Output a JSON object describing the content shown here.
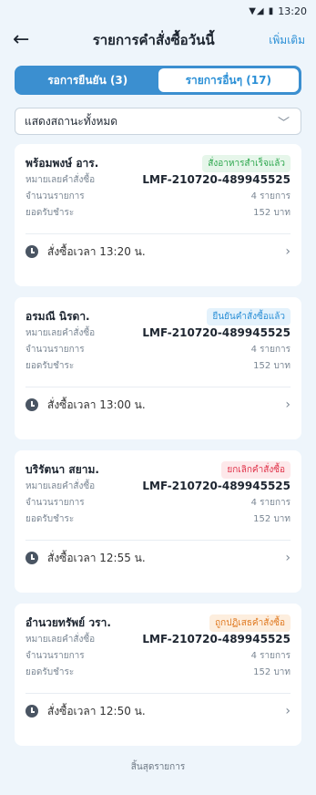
{
  "status": {
    "time": "13:20"
  },
  "header": {
    "title": "รายการคำสั่งซื้อวันนี้",
    "add_label": "เพิ่มเติม"
  },
  "tabs": [
    {
      "label": "รอการยืนยัน (3)",
      "active": false
    },
    {
      "label": "รายการอื่นๆ (17)",
      "active": true
    }
  ],
  "filter": {
    "label": "แสดงสถานะทั้งหมด"
  },
  "labels": {
    "order_no": "หมายเลยคำสั่งซื้อ",
    "items": "จำนวนรายการ",
    "payment": "ยอดรับชำระ"
  },
  "orders": [
    {
      "name": "พร้อมพงษ์ อาร.",
      "status": "สั่งอาหารสำเร็จแล้ว",
      "order_no": "LMF-210720-489945525",
      "items": "4 รายการ",
      "payment": "152 บาท",
      "time": "สั่งซื้อเวลา 13:20 น."
    },
    {
      "name": "อรมณี นิรดา.",
      "status": "ยืนยันคำสั่งซื้อแล้ว",
      "order_no": "LMF-210720-489945525",
      "items": "4 รายการ",
      "payment": "152 บาท",
      "time": "สั่งซื้อเวลา 13:00 น."
    },
    {
      "name": "บริรัตนา สยาม.",
      "status": "ยกเลิกคำสั่งซื้อ",
      "order_no": "LMF-210720-489945525",
      "items": "4 รายการ",
      "payment": "152 บาท",
      "time": "สั่งซื้อเวลา 12:55 น."
    },
    {
      "name": "อำนวยทรัพย์ วรา.",
      "status": "ถูกปฏิเสธคำสั่งซื้อ",
      "order_no": "LMF-210720-489945525",
      "items": "4 รายการ",
      "payment": "152 บาท",
      "time": "สั่งซื้อเวลา 12:50 น."
    }
  ],
  "end_text": "สิ้นสุดรายการ"
}
